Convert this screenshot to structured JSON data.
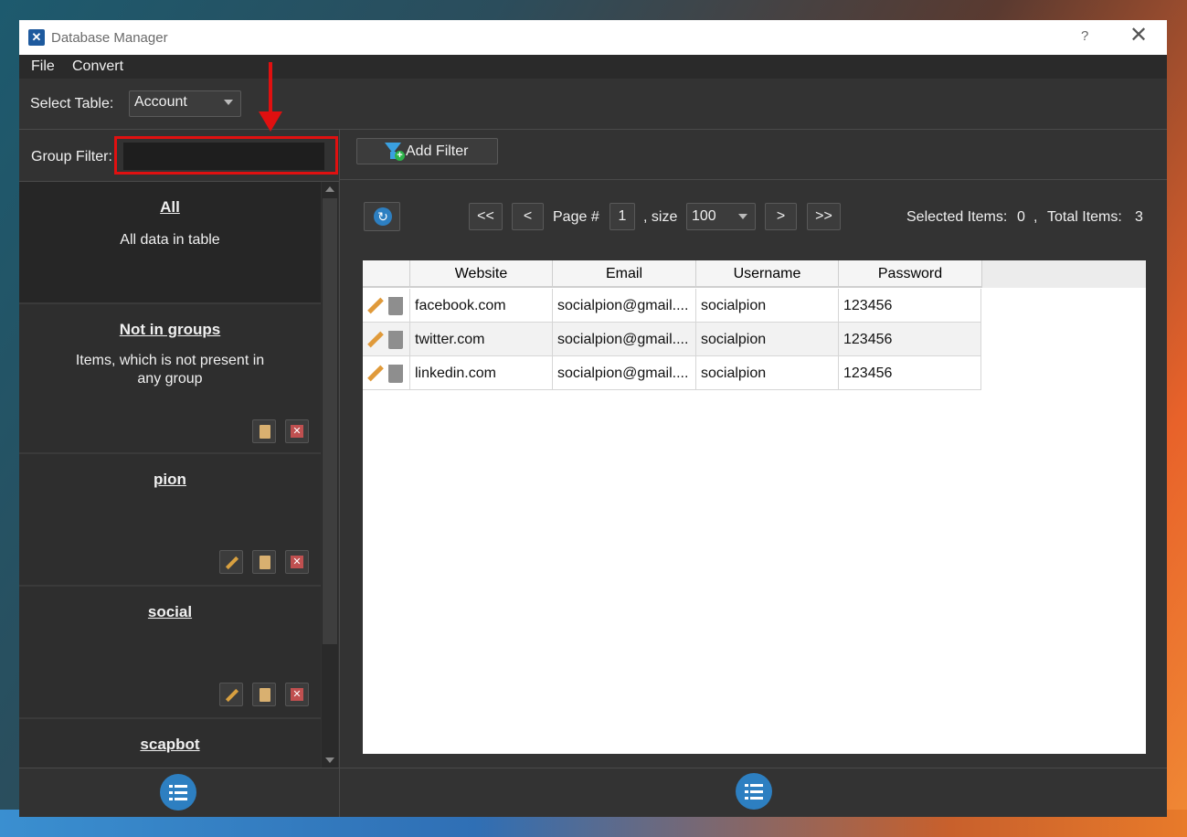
{
  "window": {
    "title": "Database Manager",
    "help": "?",
    "close": "✕"
  },
  "menu": [
    "File",
    "Convert"
  ],
  "toolbar": {
    "select_table_label": "Select Table:",
    "table_value": "Account"
  },
  "group_filter": {
    "label": "Group Filter:",
    "value": ""
  },
  "groups": [
    {
      "title": "All",
      "desc": "All data in table"
    },
    {
      "title": "Not in groups",
      "desc": "Items, which is not present in any group"
    },
    {
      "title": "pion",
      "desc": ""
    },
    {
      "title": "social",
      "desc": ""
    },
    {
      "title": "scapbot",
      "desc": ""
    }
  ],
  "filter_bar": {
    "add_filter": "Add Filter"
  },
  "pager": {
    "first": "<<",
    "prev": "<",
    "page_label": "Page #",
    "page": "1",
    "size_label": ", size",
    "size": "100",
    "next": ">",
    "last": ">>",
    "selected_label": "Selected Items:",
    "selected": "0",
    "sep": ",",
    "total_label": "Total Items:",
    "total": "3"
  },
  "table": {
    "columns": [
      "Website",
      "Email",
      "Username",
      "Password"
    ],
    "rows": [
      [
        "facebook.com",
        "socialpion@gmail....",
        "socialpion",
        "123456"
      ],
      [
        "twitter.com",
        "socialpion@gmail....",
        "socialpion",
        "123456"
      ],
      [
        "linkedin.com",
        "socialpion@gmail....",
        "socialpion",
        "123456"
      ]
    ]
  },
  "colors": {
    "accent": "#2d7fc1",
    "highlight": "#e01010",
    "panel": "#323232"
  }
}
